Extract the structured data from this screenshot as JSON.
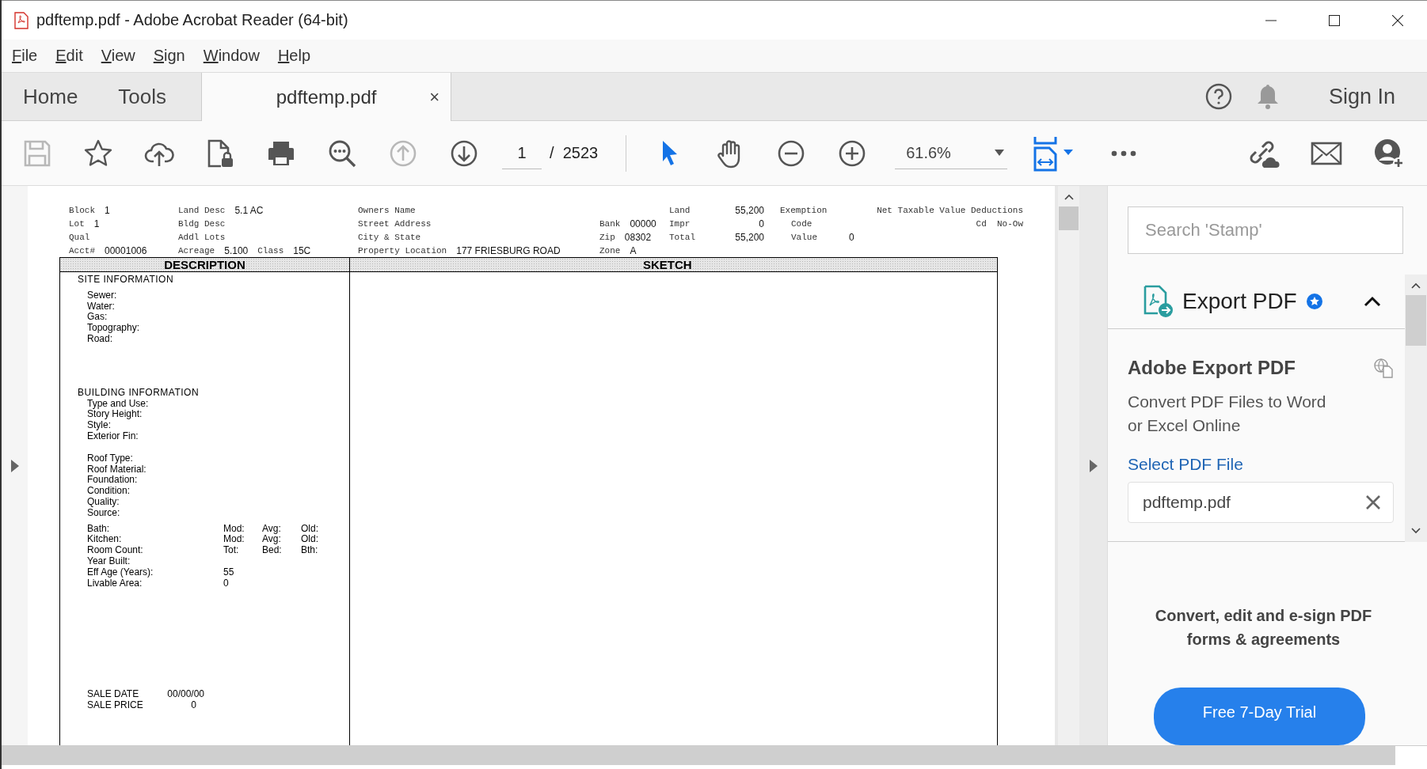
{
  "window": {
    "title": "pdftemp.pdf - Adobe Acrobat Reader (64-bit)"
  },
  "menu": [
    "File",
    "Edit",
    "View",
    "Sign",
    "Window",
    "Help"
  ],
  "tabs": [
    {
      "label": "Home",
      "kind": "nav",
      "selected": false
    },
    {
      "label": "Tools",
      "kind": "nav",
      "selected": false
    },
    {
      "label": "pdftemp.pdf",
      "kind": "document",
      "selected": true,
      "close": "×"
    }
  ],
  "account": {
    "sign_in": "Sign In"
  },
  "toolbar": {
    "tools": [
      {
        "kind": "save",
        "disabled": true
      },
      {
        "kind": "star",
        "disabled": false
      },
      {
        "kind": "upload",
        "disabled": false
      },
      {
        "kind": "lock",
        "disabled": false
      },
      {
        "kind": "print",
        "disabled": false
      },
      {
        "kind": "find",
        "disabled": false
      },
      {
        "kind": "prev",
        "disabled": true
      },
      {
        "kind": "next",
        "disabled": false
      }
    ],
    "page": "1",
    "page_total": "/  2523",
    "modes": [
      {
        "kind": "select",
        "selected": true
      },
      {
        "kind": "hand",
        "selected": false
      }
    ],
    "zoom": "61.6%"
  },
  "document": {
    "header": [
      {
        "rows": [
          [
            {
              "kind": "label",
              "text": "Block"
            },
            {
              "kind": "value",
              "text": "1"
            }
          ],
          [
            {
              "kind": "label",
              "text": "Lot"
            },
            {
              "kind": "value",
              "text": "1"
            }
          ],
          [
            {
              "kind": "label",
              "text": "Qual"
            }
          ],
          [
            {
              "kind": "label",
              "text": "Acct#"
            },
            {
              "kind": "value",
              "text": "00001006"
            }
          ]
        ]
      },
      {
        "rows": [
          [
            {
              "kind": "label",
              "text": "Land Desc"
            },
            {
              "kind": "value",
              "text": "5.1 AC"
            }
          ],
          [
            {
              "kind": "label",
              "text": "Bldg Desc"
            }
          ],
          [
            {
              "kind": "label",
              "text": "Addl Lots"
            }
          ],
          [
            {
              "kind": "label",
              "text": "Acreage"
            },
            {
              "kind": "value",
              "text": "5.100"
            },
            {
              "kind": "label",
              "text": "Class"
            },
            {
              "kind": "value",
              "text": "15C"
            }
          ]
        ]
      },
      {
        "rows": [
          [
            {
              "kind": "label",
              "text": "Owners Name"
            }
          ],
          [
            {
              "kind": "label",
              "text": "Street Address"
            }
          ],
          [
            {
              "kind": "label",
              "text": "City & State"
            }
          ],
          [
            {
              "kind": "label",
              "text": "Property Location"
            },
            {
              "kind": "value",
              "text": "177 FRIESBURG ROAD"
            }
          ]
        ]
      },
      {
        "rows": [
          [
            {
              "kind": "label",
              "text": "Bank"
            },
            {
              "kind": "value",
              "text": "00000"
            }
          ],
          [
            {
              "kind": "label",
              "text": "Zip"
            },
            {
              "kind": "value",
              "text": "08302"
            }
          ],
          [
            {
              "kind": "label",
              "text": "Zone"
            },
            {
              "kind": "value",
              "text": "A"
            }
          ]
        ]
      },
      {
        "rows": [
          [
            {
              "kind": "label",
              "text": "Land"
            },
            {
              "kind": "value",
              "text": "55,200"
            }
          ],
          [
            {
              "kind": "label",
              "text": "Impr"
            },
            {
              "kind": "value",
              "text": "0"
            }
          ],
          [
            {
              "kind": "label",
              "text": "Total"
            },
            {
              "kind": "value",
              "text": "55,200"
            }
          ]
        ]
      },
      {
        "rows": [
          [
            {
              "kind": "label",
              "text": "Exemption"
            }
          ],
          [
            {
              "kind": "label",
              "text": "Code"
            }
          ],
          [
            {
              "kind": "label",
              "text": "Value"
            },
            {
              "kind": "value",
              "text": "0"
            }
          ]
        ]
      },
      {
        "rows": [
          [
            {
              "kind": "label",
              "text": "Net Taxable Value Deductions"
            }
          ],
          [
            {
              "kind": "label",
              "text": "Cd  No-Ow"
            }
          ]
        ]
      }
    ],
    "description_title": "DESCRIPTION",
    "sketch_title": "SKETCH",
    "sections": [
      {
        "title": "SITE INFORMATION",
        "groups": [
          [
            {
              "label": "Sewer:"
            },
            {
              "label": "Water:"
            },
            {
              "label": "Gas:"
            },
            {
              "label": "Topography:"
            },
            {
              "label": "Road:"
            }
          ]
        ]
      },
      {
        "title": "BUILDING INFORMATION",
        "groups": [
          [
            {
              "label": "Type and Use:"
            },
            {
              "label": "Story Height:"
            },
            {
              "label": "Style:"
            },
            {
              "label": "Exterior Fin:"
            }
          ],
          [
            {
              "label": "Roof Type:"
            },
            {
              "label": "Roof Material:"
            },
            {
              "label": "Foundation:"
            },
            {
              "label": "Condition:"
            },
            {
              "label": "Quality:"
            },
            {
              "label": "Source:"
            }
          ],
          [
            {
              "label": "Bath:",
              "values": [
                "Mod:",
                "Avg:",
                "Old:"
              ]
            },
            {
              "label": "Kitchen:",
              "values": [
                "Mod:",
                "Avg:",
                "Old:"
              ]
            },
            {
              "label": "Room Count:",
              "values": [
                "Tot:",
                "Bed:",
                "Bth:"
              ]
            },
            {
              "label": "Year Built:"
            },
            {
              "label": "Eff Age (Years):",
              "values": [
                "55"
              ]
            },
            {
              "label": "Livable Area:",
              "values": [
                "0"
              ]
            }
          ]
        ]
      }
    ],
    "sale": [
      {
        "label": "SALE DATE",
        "value": "00/00/00"
      },
      {
        "label": "SALE PRICE",
        "value": "0"
      }
    ]
  },
  "side_panel": {
    "search": {
      "placeholder": "Search 'Stamp'"
    },
    "tool": {
      "title": "Export PDF",
      "expanded": true,
      "heading": "Adobe Export PDF",
      "description": "Convert PDF Files to Word or Excel Online",
      "link": "Select PDF File",
      "file": "pdftemp.pdf"
    },
    "promo": {
      "text": "Convert, edit and e-sign PDF forms & agreements",
      "button": "Free 7-Day Trial"
    }
  }
}
